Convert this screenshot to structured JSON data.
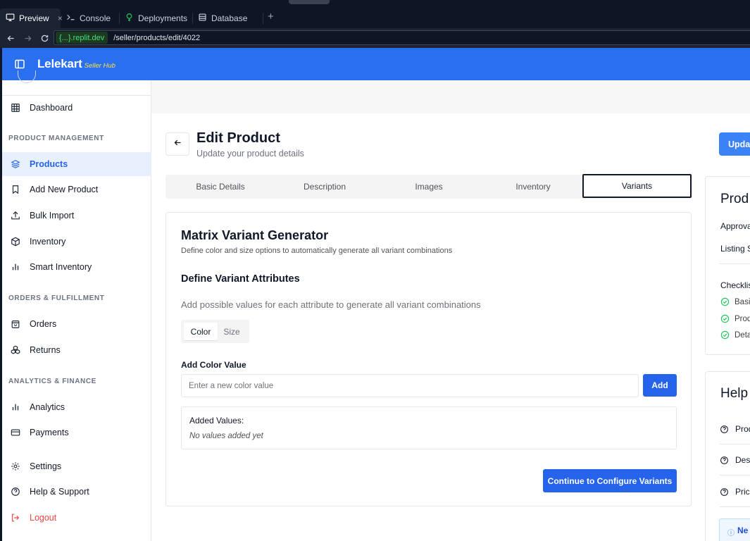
{
  "ide": {
    "tabs": [
      {
        "label": "Preview",
        "icon": "monitor-icon",
        "active": true
      },
      {
        "label": "Console",
        "icon": "terminal-icon"
      },
      {
        "label": "Deployments",
        "icon": "deployments-icon"
      },
      {
        "label": "Database",
        "icon": "database-icon"
      }
    ],
    "close_symbol": "×",
    "add_tab_symbol": "+",
    "url": {
      "domain_chip": "{...}.replit.dev",
      "path": "/seller/products/edit/4022"
    }
  },
  "header": {
    "brand": "Lelekart",
    "brand_sub": "Seller Hub"
  },
  "sidebar": {
    "top_item": {
      "label": "Dashboard",
      "icon": "grid-icon"
    },
    "sections": [
      {
        "title": "PRODUCT MANAGEMENT"
      },
      {
        "title": "ORDERS & FULFILLMENT"
      },
      {
        "title": "ANALYTICS & FINANCE"
      }
    ],
    "items": [
      {
        "label": "Products",
        "icon": "layers-icon",
        "active": true
      },
      {
        "label": "Add New Product",
        "icon": "bookmark-icon"
      },
      {
        "label": "Bulk Import",
        "icon": "upload-icon"
      },
      {
        "label": "Inventory",
        "icon": "package-icon"
      },
      {
        "label": "Smart Inventory",
        "icon": "bar-chart-icon"
      },
      {
        "label": "Orders",
        "icon": "shopping-bag-icon"
      },
      {
        "label": "Returns",
        "icon": "boxes-icon"
      },
      {
        "label": "Analytics",
        "icon": "bar-chart-icon"
      },
      {
        "label": "Payments",
        "icon": "credit-card-icon"
      },
      {
        "label": "Settings",
        "icon": "gear-icon"
      },
      {
        "label": "Help & Support",
        "icon": "help-circle-icon"
      },
      {
        "label": "Logout",
        "icon": "logout-icon"
      }
    ]
  },
  "page": {
    "title": "Edit Product",
    "subtitle": "Update your product details",
    "update_button": "Upda"
  },
  "tabs": [
    "Basic Details",
    "Description",
    "Images",
    "Inventory",
    "Variants"
  ],
  "active_tab": "Variants",
  "variant_card": {
    "title": "Matrix Variant Generator",
    "description": "Define color and size options to automatically generate all variant combinations",
    "section_title": "Define Variant Attributes",
    "section_description": "Add possible values for each attribute to generate all variant combinations",
    "attribute_tabs": [
      "Color",
      "Size"
    ],
    "active_attribute": "Color",
    "input_label": "Add Color Value",
    "input_placeholder": "Enter a new color value",
    "input_value": "",
    "add_button": "Add",
    "added_values_title": "Added Values:",
    "added_values_empty": "No values added yet",
    "continue_button": "Continue to Configure Variants"
  },
  "status_panel": {
    "title": "Prod",
    "approval_label": "Approva",
    "listing_label": "Listing S",
    "checklist_title": "Checklis",
    "checklist": [
      "Basic",
      "Prod",
      "Deta"
    ]
  },
  "help_panel": {
    "title": "Help",
    "items": [
      "Prod",
      "Desc",
      "Prici"
    ],
    "notice_icon": "ⓘ",
    "notice_text": "Ne"
  },
  "colors": {
    "brand_blue": "#2a6ff0",
    "primary_button": "#2563eb",
    "accent_yellow": "#fde047",
    "success_green": "#22c55e",
    "danger_red": "#ef4444",
    "ide_dark": "#0e1525"
  }
}
